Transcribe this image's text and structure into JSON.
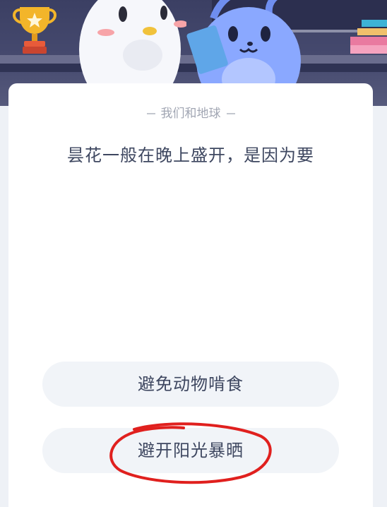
{
  "quiz": {
    "category": "我们和地球",
    "question": "昙花一般在晚上盛开，是因为要",
    "options": [
      {
        "label": "避免动物啃食"
      },
      {
        "label": "避开阳光暴晒"
      }
    ]
  },
  "annotation": {
    "type": "hand-drawn-circle",
    "color": "#e0201e",
    "target": "option-2"
  },
  "icons": [
    "trophy-icon",
    "books-icon"
  ],
  "colors": {
    "banner": "#474b70",
    "card": "#ffffff",
    "option_bg": "#f1f4f8",
    "text": "#3e4760",
    "category_text": "#a1a6b3"
  }
}
